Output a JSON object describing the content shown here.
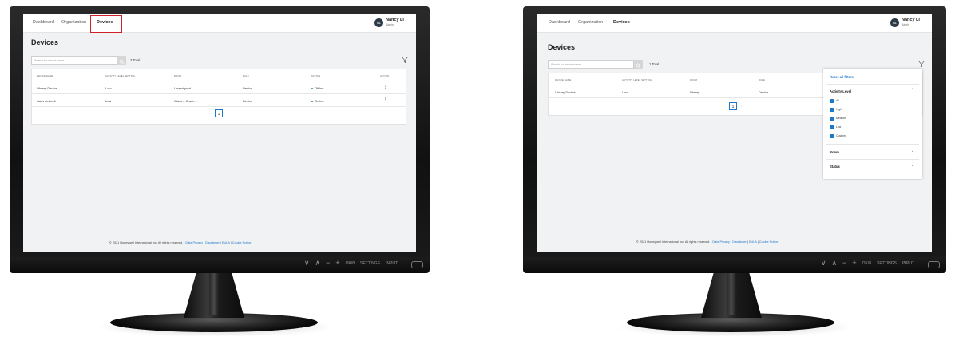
{
  "screens": [
    {
      "tabs": [
        "Dashboard",
        "Organization",
        "Devices"
      ],
      "active_tab": "Devices",
      "user": {
        "initials": "NL",
        "name": "Nancy Li",
        "role": "Admin"
      },
      "page_title": "Devices",
      "search_placeholder": "Search for device name",
      "total_label": "2 Total",
      "columns": [
        "DEVICE NAME",
        "ACTIVITY LEVEL SETTING",
        "ROOM",
        "RULE",
        "STATUS",
        "ACTION"
      ],
      "rows": [
        {
          "device": "Library Device",
          "level": "Low",
          "room": "Unassigned",
          "rule": "Device",
          "status": "Offline",
          "status_color": "#2e8b57"
        },
        {
          "device": "class device1",
          "level": "Low",
          "room": "Class 4 Grade 1",
          "rule": "Device",
          "status": "Online",
          "status_color": "#2e8b57"
        }
      ],
      "page": "1"
    },
    {
      "tabs": [
        "Dashboard",
        "Organization",
        "Devices"
      ],
      "active_tab": "Devices",
      "user": {
        "initials": "NL",
        "name": "Nancy Li",
        "role": "Admin"
      },
      "page_title": "Devices",
      "search_placeholder": "Search for device name",
      "total_label": "1 Total",
      "columns": [
        "DEVICE NAME",
        "ACTIVITY LEVEL SETTING",
        "ROOM",
        "RULE"
      ],
      "rows": [
        {
          "device": "Library Device",
          "level": "Low",
          "room": "Library",
          "rule": "Device"
        }
      ],
      "page": "1",
      "filter_panel": {
        "reset_label": "Reset all filters",
        "activity_label": "Activity Level",
        "options": [
          "All",
          "High",
          "Medium",
          "Low",
          "Custom"
        ],
        "room_label": "Room",
        "status_label": "Status"
      }
    }
  ],
  "footer": {
    "copyright": "© 2021 Honeywell International Inc. All rights reserved.",
    "sep": "|",
    "links": [
      "Data Privacy",
      "Disclaimer",
      "EULA",
      "Cookie Notice"
    ]
  },
  "monitor_controls": {
    "down": "∨",
    "up": "∧",
    "minus": "−",
    "plus": "+",
    "osd": "OK/8",
    "settings": "SETTINGS",
    "input": "INPUT"
  },
  "colors": {
    "accent": "#1d78c8",
    "highlight": "#d0202a",
    "online": "#2e8b57"
  }
}
